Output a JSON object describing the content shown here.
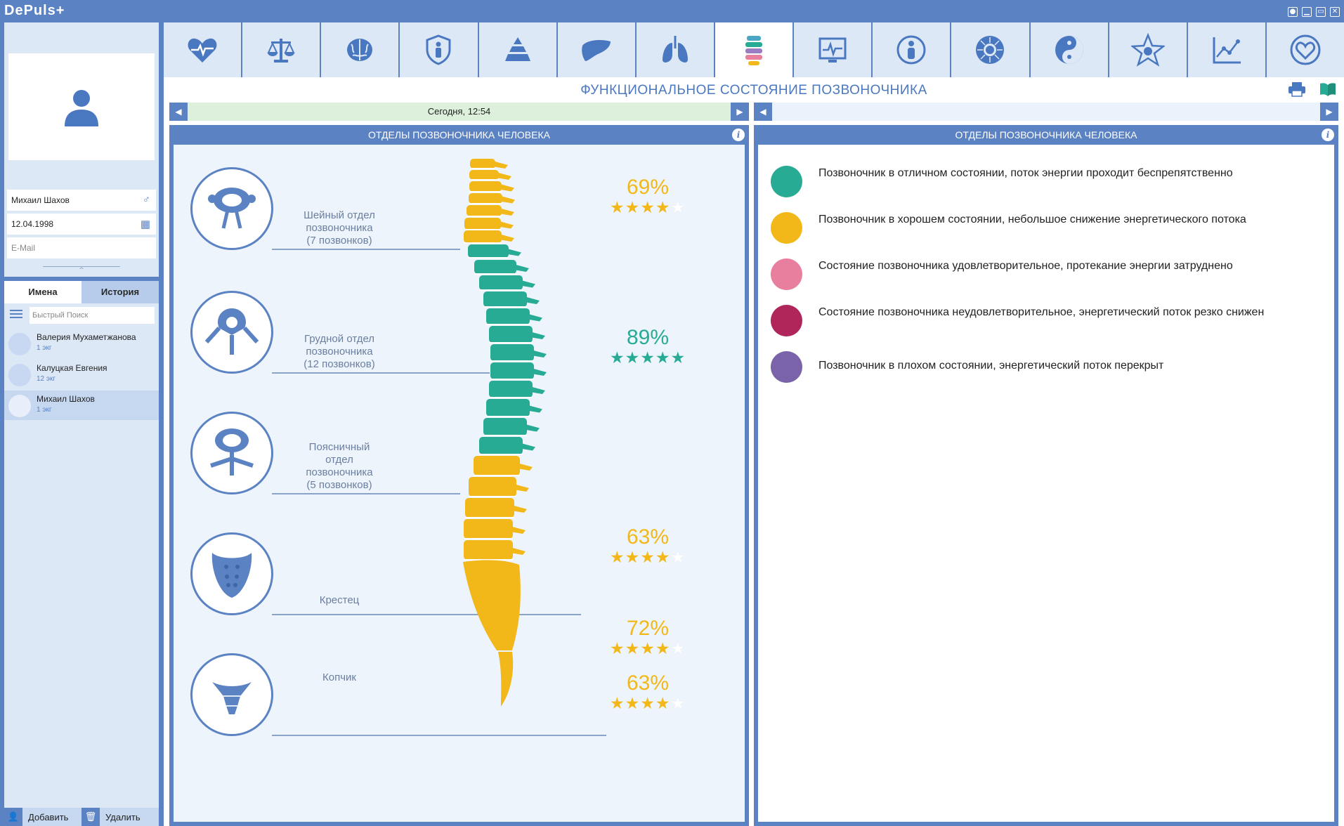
{
  "app": {
    "title": "DePuls+",
    "window_controls": [
      "●",
      "▁",
      "▭",
      "✕"
    ]
  },
  "sidebar": {
    "profile": {
      "name": "Михаил Шахов",
      "birthdate": "12.04.1998",
      "email_placeholder": "E-Mail"
    },
    "collapse_glyph": "^",
    "tabs": [
      {
        "label": "Имена",
        "active": true
      },
      {
        "label": "История",
        "active": false
      }
    ],
    "search": {
      "placeholder": "Быстрый Поиск"
    },
    "people": [
      {
        "name": "Валерия Мухаметжанова",
        "sub": "1 экг",
        "selected": false
      },
      {
        "name": "Калуцкая Евгения",
        "sub": "12 экг",
        "selected": false
      },
      {
        "name": "Михаил Шахов",
        "sub": "1 экг",
        "selected": true
      }
    ],
    "buttons": {
      "add": "Добавить",
      "delete": "Удалить"
    }
  },
  "toolbar": {
    "tools": [
      {
        "icon": "heart-pulse-icon",
        "active": false
      },
      {
        "icon": "scales-icon",
        "active": false
      },
      {
        "icon": "brain-icon",
        "active": false
      },
      {
        "icon": "shield-person-icon",
        "active": false
      },
      {
        "icon": "pyramid-icon",
        "active": false
      },
      {
        "icon": "liver-icon",
        "active": false
      },
      {
        "icon": "lungs-icon",
        "active": false
      },
      {
        "icon": "spine-icon",
        "active": true
      },
      {
        "icon": "monitor-pulse-icon",
        "active": false
      },
      {
        "icon": "person-circle-icon",
        "active": false
      },
      {
        "icon": "sun-icon",
        "active": false
      },
      {
        "icon": "yin-yang-icon",
        "active": false
      },
      {
        "icon": "star-icon",
        "active": false
      },
      {
        "icon": "chart-icon",
        "active": false
      },
      {
        "icon": "heart-hands-icon",
        "active": false
      }
    ]
  },
  "main": {
    "title": "ФУНКЦИОНАЛЬНОЕ СОСТОЯНИЕ ПОЗВОНОЧНИКА",
    "date_label": "Сегодня, 12:54",
    "left_panel": {
      "heading": "ОТДЕЛЫ ПОЗВОНОЧНИКА ЧЕЛОВЕКА",
      "sections": [
        {
          "label_lines": [
            "Шейный отдел",
            "позвоночника",
            "(7 позвонков)"
          ],
          "icon": "cervical-vertebra-icon"
        },
        {
          "label_lines": [
            "Грудной отдел",
            "позвоночника",
            "(12 позвонков)"
          ],
          "icon": "thoracic-vertebra-icon"
        },
        {
          "label_lines": [
            "Поясничный",
            "отдел",
            "позвоночника",
            "(5 позвонков)"
          ],
          "icon": "lumbar-vertebra-icon"
        },
        {
          "label_lines": [
            "Крестец"
          ],
          "icon": "sacrum-icon"
        },
        {
          "label_lines": [
            "Копчик"
          ],
          "icon": "coccyx-icon"
        }
      ],
      "scores": [
        {
          "percent": "69%",
          "stars": 4,
          "color": "#f2b81a"
        },
        {
          "percent": "89%",
          "stars": 5,
          "color": "#27ab94"
        },
        {
          "percent": "63%",
          "stars": 4,
          "color": "#f2b81a"
        },
        {
          "percent": "72%",
          "stars": 4,
          "color": "#f2b81a"
        },
        {
          "percent": "63%",
          "stars": 4,
          "color": "#f2b81a"
        }
      ]
    },
    "right_panel": {
      "heading": "ОТДЕЛЫ ПОЗВОНОЧНИКА ЧЕЛОВЕКА",
      "legend": [
        {
          "color": "#27ab94",
          "text": "Позвоночник в отличном состоянии, поток энергии проходит беспрепятственно"
        },
        {
          "color": "#f2b81a",
          "text": "Позвоночник в хорошем состоянии, небольшое снижение энергетического потока"
        },
        {
          "color": "#e97f9e",
          "text": "Состояние позвоночника удовлетворительное, протекание энергии затруднено"
        },
        {
          "color": "#b0255a",
          "text": "Состояние позвоночника неудовлетворительное, энергетический поток резко снижен"
        },
        {
          "color": "#7a63a8",
          "text": "Позвоночник в плохом состоянии, энергетический поток перекрыт"
        }
      ]
    }
  },
  "colors": {
    "accent": "#5b82c2",
    "good": "#f2b81a",
    "excellent": "#27ab94"
  }
}
